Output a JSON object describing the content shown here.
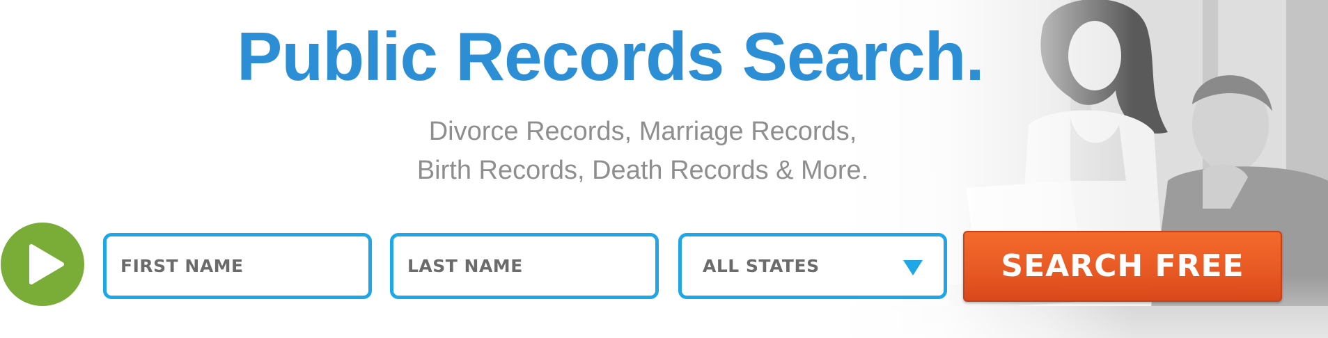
{
  "hero": {
    "title": "Public Records Search.",
    "subtitle_line1": "Divorce Records, Marriage Records,",
    "subtitle_line2": "Birth Records, Death Records & More."
  },
  "form": {
    "first_name": {
      "placeholder": "FIRST NAME",
      "value": ""
    },
    "last_name": {
      "placeholder": "LAST NAME",
      "value": ""
    },
    "state": {
      "selected": "ALL STATES"
    },
    "submit_label": "SEARCH FREE"
  },
  "icons": {
    "play": "play-icon",
    "dropdown": "chevron-down-icon"
  },
  "colors": {
    "title": "#2c8fd6",
    "subtitle": "#8e8e8e",
    "field_border": "#1ea6e6",
    "play_button": "#79ad38",
    "submit_button": "#e85a24"
  }
}
